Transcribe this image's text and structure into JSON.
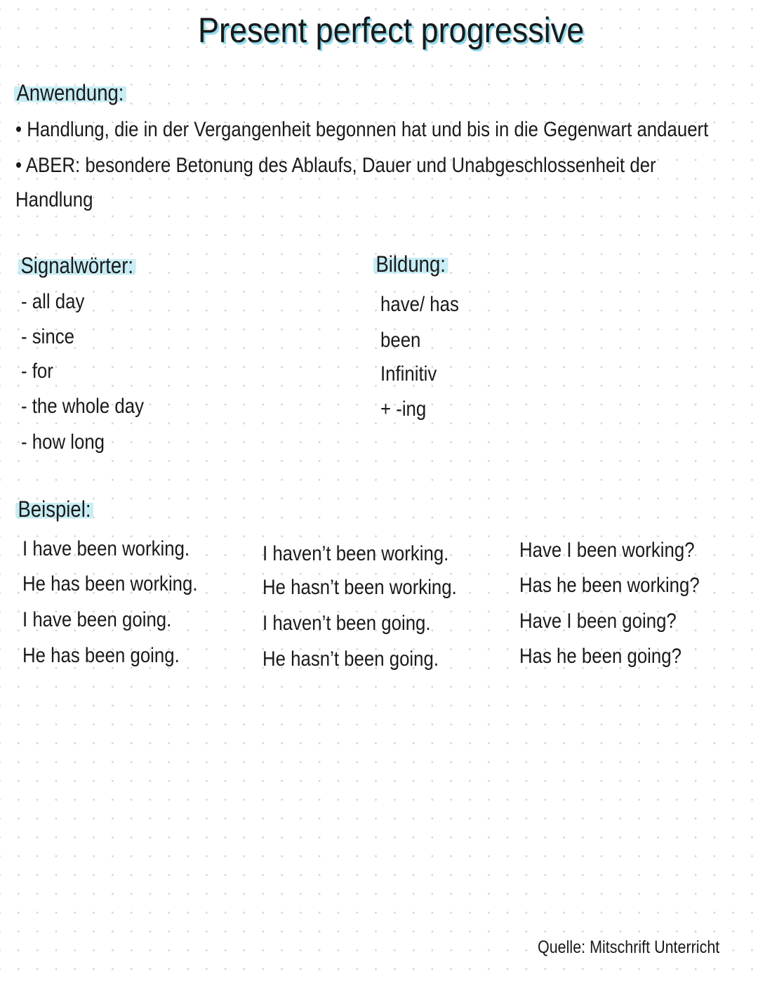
{
  "title": "Present perfect progressive",
  "accent_color": "#8fd9ea",
  "anwendung": {
    "heading": "Anwendung:",
    "lines": [
      "• Handlung, die in der Vergangenheit begonnen hat und bis in die Gegenwart andauert",
      "• ABER: besondere Betonung des Ablaufs, Dauer und Unabgeschlossenheit der",
      "Handlung"
    ]
  },
  "signalwoerter": {
    "heading": "Signalwörter:",
    "items": [
      "- all day",
      "- since",
      "- for",
      "- the whole day",
      "- how long"
    ]
  },
  "bildung": {
    "heading": "Bildung:",
    "items": [
      "have/ has",
      "been",
      "Infinitiv",
      "+ -ing"
    ]
  },
  "beispiel": {
    "heading": "Beispiel:",
    "columns": [
      {
        "type": "affirmative",
        "sentences": [
          "I have been working.",
          "He has been working.",
          "I have been going.",
          "He has been going."
        ]
      },
      {
        "type": "negative",
        "sentences": [
          "I haven’t been working.",
          "He hasn’t been working.",
          "I haven’t been going.",
          "He hasn’t been going."
        ]
      },
      {
        "type": "question",
        "sentences": [
          "Have I been working?",
          "Has he been working?",
          "Have I been going?",
          "Has he been going?"
        ]
      }
    ]
  },
  "source": "Quelle: Mitschrift Unterricht"
}
